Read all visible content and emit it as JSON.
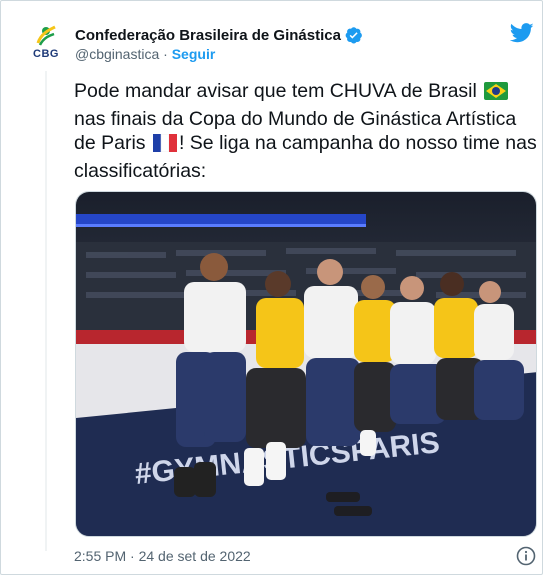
{
  "account": {
    "avatar_text": "CBG",
    "display_name": "Confederação Brasileira de Ginástica",
    "handle": "@cbginastica",
    "separator": " · ",
    "follow_label": "Seguir"
  },
  "tweet": {
    "line1": "Pode mandar avisar que tem CHUVA de Brasil",
    "line2": "nas finais da Copa do Mundo de Ginástica Artística",
    "line3_a": "de Paris",
    "line3_b": "! Se liga na campanha do nosso time nas",
    "line4": "classificatórias:",
    "flag_icons": [
      "brazil-flag-icon",
      "france-flag-icon"
    ]
  },
  "media": {
    "banner_text": "#GYMNASTICSPARIS",
    "colors": {
      "yellow": "#f5c518",
      "navy": "#2b3a6b",
      "white": "#f2f2f2",
      "floor": "#1f2c52"
    }
  },
  "footer": {
    "timestamp": "2:55 PM · 24 de set de 2022"
  },
  "colors": {
    "accent": "#1d9bf0",
    "text": "#0f1419",
    "muted": "#536471"
  }
}
